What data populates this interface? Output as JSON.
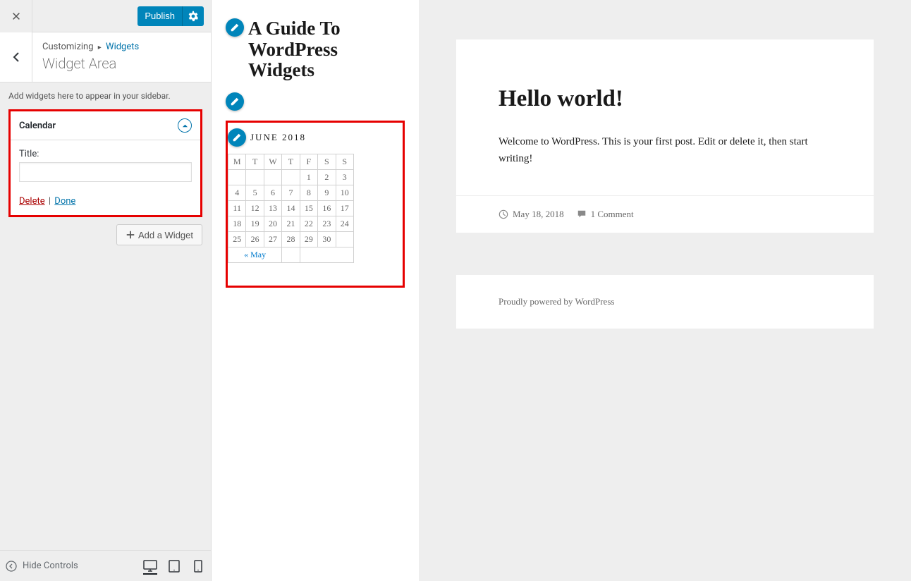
{
  "top": {
    "publish": "Publish"
  },
  "breadcrumb": {
    "root": "Customizing",
    "parent": "Widgets",
    "title": "Widget Area"
  },
  "sidebar": {
    "description": "Add widgets here to appear in your sidebar.",
    "widget": {
      "name": "Calendar",
      "title_label": "Title:",
      "title_value": "",
      "delete": "Delete",
      "done": "Done"
    },
    "add_widget": "Add a Widget",
    "hide_controls": "Hide Controls"
  },
  "preview": {
    "site_title": "A Guide To WordPress Widgets",
    "calendar": {
      "caption": "JUNE 2018",
      "dow": [
        "M",
        "T",
        "W",
        "T",
        "F",
        "S",
        "S"
      ],
      "weeks": [
        [
          "",
          "",
          "",
          "",
          "1",
          "2",
          "3"
        ],
        [
          "4",
          "5",
          "6",
          "7",
          "8",
          "9",
          "10"
        ],
        [
          "11",
          "12",
          "13",
          "14",
          "15",
          "16",
          "17"
        ],
        [
          "18",
          "19",
          "20",
          "21",
          "22",
          "23",
          "24"
        ],
        [
          "25",
          "26",
          "27",
          "28",
          "29",
          "30",
          ""
        ]
      ],
      "prev": "« May"
    },
    "post": {
      "title": "Hello world!",
      "body": "Welcome to WordPress. This is your first post. Edit or delete it, then start writing!",
      "date": "May 18, 2018",
      "comments": "1 Comment"
    },
    "footer": "Proudly powered by WordPress"
  }
}
